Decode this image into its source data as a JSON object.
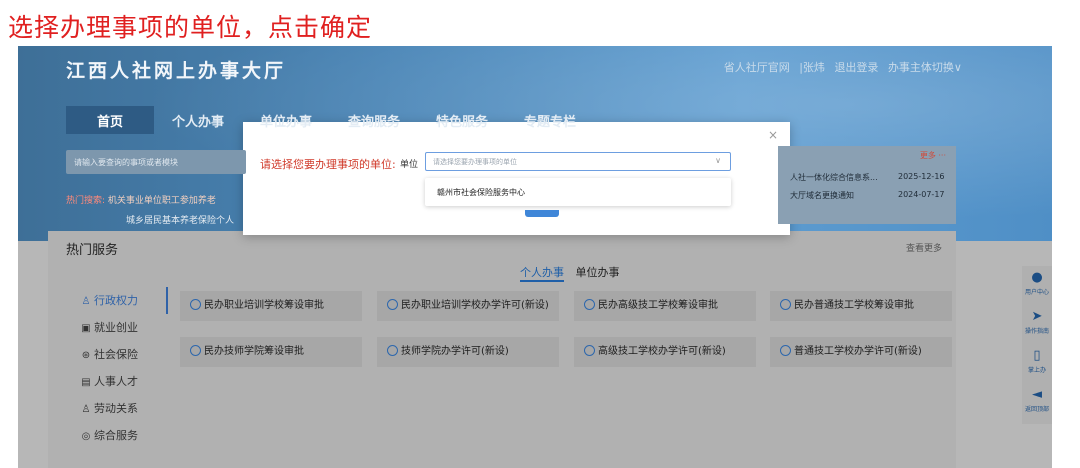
{
  "instruction": "选择办理事项的单位，点击确定",
  "header": {
    "logo": "江西人社网上办事大厅",
    "links": [
      "省人社厅官网",
      "|张炜",
      "退出登录",
      "办事主体切换∨"
    ]
  },
  "nav": [
    "首页",
    "个人办事",
    "单位办事",
    "查询服务",
    "特色服务",
    "专题专栏"
  ],
  "search": {
    "placeholder": "请输入要查询的事项或者模块"
  },
  "hot_search": {
    "label": "热门搜索:",
    "line1": "机关事业单位职工参加养老",
    "line2": "城乡居民基本养老保险个人"
  },
  "notice": {
    "more": "更多 ···",
    "items": [
      {
        "title": "人社一体化综合信息系...",
        "date": "2025-12-16"
      },
      {
        "title": "大厅域名更换通知",
        "date": "2024-07-17"
      }
    ]
  },
  "hot_services": {
    "title": "热门服务",
    "view_more": "查看更多",
    "tabs": [
      "个人办事",
      "单位办事"
    ],
    "side_menu": [
      {
        "label": "行政权力",
        "icon": "person-icon"
      },
      {
        "label": "就业创业",
        "icon": "briefcase-icon"
      },
      {
        "label": "社会保险",
        "icon": "shield-icon"
      },
      {
        "label": "人事人才",
        "icon": "id-card-icon"
      },
      {
        "label": "劳动关系",
        "icon": "people-icon"
      },
      {
        "label": "综合服务",
        "icon": "headset-icon"
      }
    ],
    "cards": [
      "民办职业培训学校筹设审批",
      "民办职业培训学校办学许可(新设)",
      "民办高级技工学校筹设审批",
      "民办普通技工学校筹设审批",
      "民办技师学院筹设审批",
      "技师学院办学许可(新设)",
      "高级技工学校办学许可(新设)",
      "普通技工学校办学许可(新设)"
    ]
  },
  "float_bar": [
    "用户中心",
    "操作指南",
    "掌上办",
    "返回顶部"
  ],
  "modal": {
    "close": "×",
    "label": "请选择您要办理事项的单位:",
    "unit_label": "单位",
    "select_placeholder": "请选择您要办理事项的单位",
    "chevron": "∨",
    "option": "赣州市社会保险服务中心"
  }
}
